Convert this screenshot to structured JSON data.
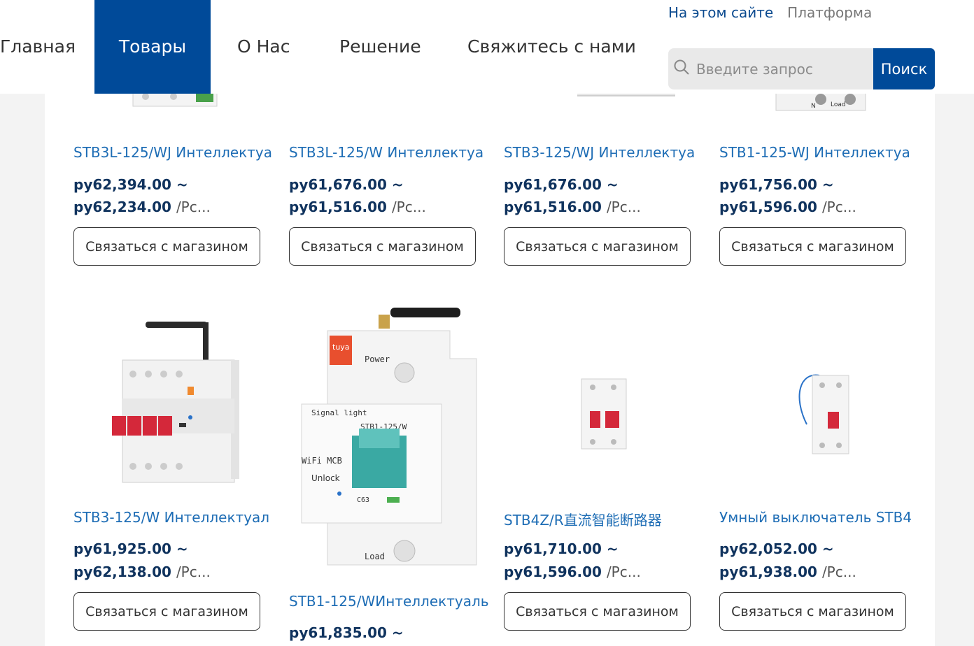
{
  "nav": {
    "items": [
      {
        "label": "Главная"
      },
      {
        "label": "Товары"
      },
      {
        "label": "О Нас"
      },
      {
        "label": "Решение"
      },
      {
        "label": "Свяжитесь с нами"
      }
    ]
  },
  "toplinks": {
    "site": "На этом сайте",
    "platform": "Платформа"
  },
  "search": {
    "placeholder": "Введите запрос",
    "button": "Поиск"
  },
  "products": [
    {
      "title": "STB3L-125/WJ Интеллектуа",
      "price_from": "ру62,394.00 ~",
      "price_to": "ру62,234.00",
      "unit": "/Pc...",
      "button": "Связаться с магазином"
    },
    {
      "title": "STB3L-125/W Интеллектуа",
      "price_from": "ру61,676.00 ~",
      "price_to": "ру61,516.00",
      "unit": "/Pc...",
      "button": "Связаться с магазином"
    },
    {
      "title": "STB3-125/WJ Интеллектуа",
      "price_from": "ру61,676.00 ~",
      "price_to": "ру61,516.00",
      "unit": "/Pc...",
      "button": "Связаться с магазином"
    },
    {
      "title": "STB1-125-WJ Интеллектуа",
      "price_from": "ру61,756.00 ~",
      "price_to": "ру61,596.00",
      "unit": "/Pc...",
      "button": "Связаться с магазином"
    },
    {
      "title": "STB3-125/W Интеллектуал",
      "price_from": "ру61,925.00 ~",
      "price_to": "ру62,138.00",
      "unit": "/Pc...",
      "button": "Связаться с магазином"
    },
    {
      "title": "STB1-125/WИнтеллектуаль",
      "price_from": "ру61,835.00 ~",
      "price_to": "",
      "unit": "",
      "button": "",
      "img_text": {
        "brand": "tuya",
        "power": "Power",
        "signal": "Signal light",
        "model": "STB1-125/W",
        "wifi": "WiFi MCB",
        "unlock": "Unlock",
        "c63": "C63",
        "load": "Load"
      }
    },
    {
      "title": "STB4Z/R直流智能断路器",
      "price_from": "ру61,710.00 ~",
      "price_to": "ру61,596.00",
      "unit": "/Pc...",
      "button": "Связаться с магазином"
    },
    {
      "title": "Умный выключатель STB4",
      "price_from": "ру62,052.00 ~",
      "price_to": "ру61,938.00",
      "unit": "/Pc...",
      "button": "Связаться с магазином"
    }
  ],
  "colors": {
    "brand": "#004a99",
    "link": "#1e6db5",
    "price": "#10335e"
  }
}
